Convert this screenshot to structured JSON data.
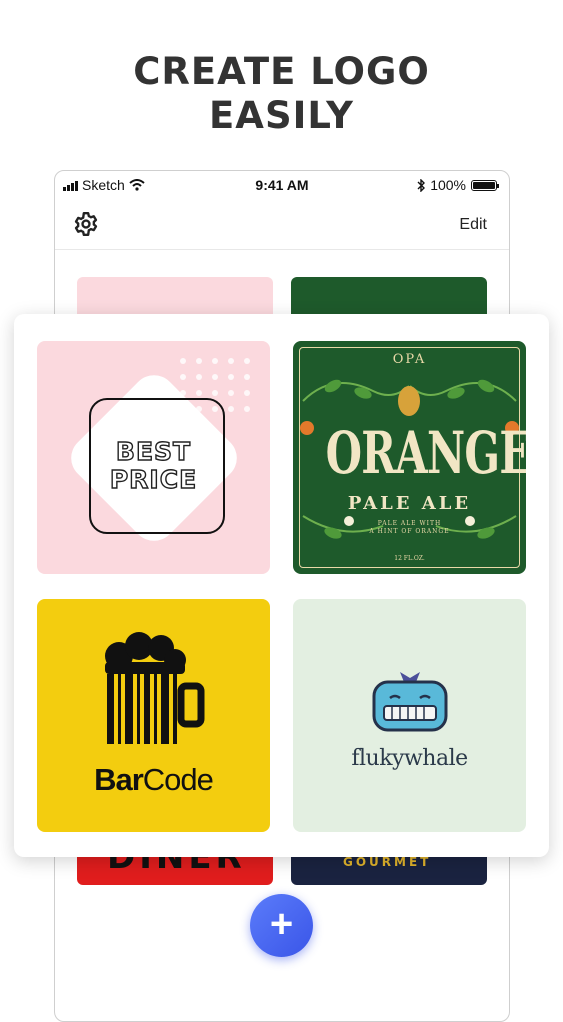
{
  "headline": {
    "line1": "CREATE LOGO",
    "line2": "EASILY"
  },
  "status_bar": {
    "carrier": "Sketch",
    "time": "9:41 AM",
    "battery": "100%",
    "battery_level": 1.0
  },
  "navbar": {
    "settings_icon": "gear-icon",
    "edit_label": "Edit"
  },
  "templates": [
    {
      "name": "best-price",
      "line1": "BEST",
      "line2": "PRICE",
      "bg": "#fbd9de"
    },
    {
      "name": "orange-pale-ale",
      "top": "OPA",
      "title": "ORANGE",
      "subtitle": "PALE ALE",
      "tagline1": "PALE ALE WITH",
      "tagline2": "A HINT OF ORANGE",
      "volume": "12 FL.OZ.",
      "bg": "#1e5a2b"
    },
    {
      "name": "barcode",
      "label_bold": "Bar",
      "label_light": "Code",
      "bg": "#f3cd0f"
    },
    {
      "name": "flukywhale",
      "label": "flukywhale",
      "bg": "#e3efe1"
    }
  ],
  "background_tiles": {
    "diner": "DINER",
    "gourmet": "GOURMET"
  },
  "fab": {
    "icon": "plus-icon",
    "label": "+"
  }
}
